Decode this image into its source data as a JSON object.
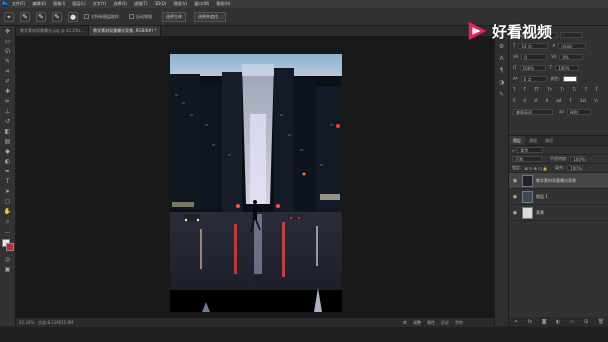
{
  "menubar": {
    "app_icon": "Ps",
    "items": [
      "文件(F)",
      "编辑(E)",
      "图像(I)",
      "图层(L)",
      "文字(Y)",
      "选择(S)",
      "滤镜(T)",
      "3D(D)",
      "视图(V)",
      "窗口(W)",
      "帮助(H)"
    ]
  },
  "options": {
    "sample_all_layers": "对所有图层取样",
    "auto_enhance": "自动增强",
    "select_subject": "选择主体",
    "select_and_mask": "选择并遮住..."
  },
  "document_tabs": [
    {
      "label": "教学素材双重曝光.jpg @ 42.2%(..."
    },
    {
      "label": "教学素材双重曝光背景, RGB/8#) *"
    }
  ],
  "status": {
    "zoom": "42.24%",
    "doc": "文档:8.11M/15.8M"
  },
  "character_panel": {
    "font_family": "Adobe 黑体 Std",
    "font_style": "-",
    "size": "14 点",
    "leading": "(自动)",
    "tracking": "0",
    "kerning": "0%",
    "scale_v": "100%",
    "scale_h": "100%",
    "baseline": "0 点",
    "color_label": "颜色:",
    "language": "美国英语",
    "antialias": "锐利"
  },
  "layers_panel": {
    "tabs": [
      "图层",
      "通道",
      "路径"
    ],
    "filter": "类型",
    "blend_mode": "正常",
    "opacity_label": "不透明度:",
    "opacity": "100%",
    "lock_label": "锁定:",
    "fill_label": "填充:",
    "fill": "100%",
    "layers": [
      {
        "name": "教学素材双重曝光背景",
        "selected": true
      },
      {
        "name": "图层 1",
        "selected": false
      },
      {
        "name": "背景",
        "selected": false
      }
    ]
  },
  "timeline_tabs": [
    "库",
    "调整",
    "属性",
    "历史",
    "字符"
  ],
  "watermark": {
    "text": "好看视频",
    "color": "#e8225a"
  }
}
